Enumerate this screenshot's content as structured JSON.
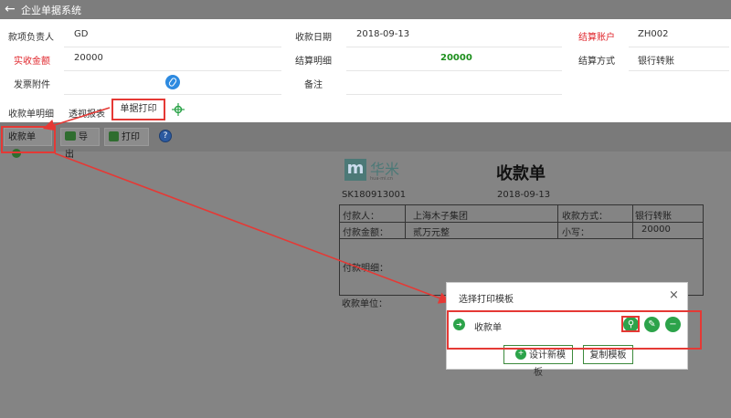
{
  "app": {
    "back_glyph": "←",
    "title": "企业单据系统"
  },
  "form": {
    "row1": {
      "label1": "款项负责人",
      "value1": "GD",
      "label2": "收款日期",
      "value2": "2018-09-13",
      "label3": "结算账户",
      "value3": "ZH002"
    },
    "row2": {
      "label1": "实收金额",
      "value1": "20000",
      "label2": "结算明细",
      "value2": "20000",
      "label3": "结算方式",
      "value3": "银行转账"
    },
    "row3": {
      "label1": "发票附件",
      "label2": "备注"
    },
    "tabs": {
      "label": "收款单明细",
      "tab1": "透视报表",
      "tab2": "单据打印"
    }
  },
  "toolbar": {
    "dropdown_label": "收款单",
    "export_label": "导出",
    "print_label": "打印",
    "help_label": "?"
  },
  "print_doc": {
    "brand": "华米",
    "brand_sub": "hua-mi.cn",
    "title": "收款单",
    "number": "SK180913001",
    "date": "2018-09-13",
    "rows": [
      {
        "label": "付款人：",
        "value": "上海木子集团",
        "label2": "收款方式：",
        "value2": "银行转账"
      },
      {
        "label": "付款金额：",
        "value": "贰万元整",
        "label2": "小写：",
        "value2": "20000"
      }
    ],
    "detail_label": "付款明细：",
    "unit_label": "收款单位："
  },
  "dialog": {
    "title": "选择打印模板",
    "close_glyph": "×",
    "template_name": "收款单",
    "new_button": "设计新模板",
    "copy_button": "复制模板"
  },
  "colors": {
    "accent_red": "#e53935",
    "action_green": "#2ca34a",
    "label_red": "#e0262c"
  }
}
